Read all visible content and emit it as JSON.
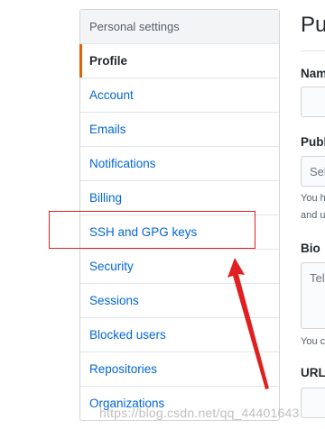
{
  "sidebar": {
    "heading": "Personal settings",
    "items": [
      {
        "label": "Profile"
      },
      {
        "label": "Account"
      },
      {
        "label": "Emails"
      },
      {
        "label": "Notifications"
      },
      {
        "label": "Billing"
      },
      {
        "label": "SSH and GPG keys"
      },
      {
        "label": "Security"
      },
      {
        "label": "Sessions"
      },
      {
        "label": "Blocked users"
      },
      {
        "label": "Repositories"
      },
      {
        "label": "Organizations"
      }
    ]
  },
  "form": {
    "title": "Pu",
    "name_label": "Nam",
    "public_email_label": "Publ",
    "public_email_select": "Sel",
    "public_email_note_1": "You h",
    "public_email_note_2": "and u",
    "bio_label": "Bio",
    "bio_placeholder": "Tel",
    "bio_note": "You c",
    "url_label": "URL"
  },
  "watermark": "https://blog.csdn.net/qq_44401643",
  "colors": {
    "accent": "#e36209",
    "link": "#0366d6",
    "annotation": "#e02020"
  }
}
